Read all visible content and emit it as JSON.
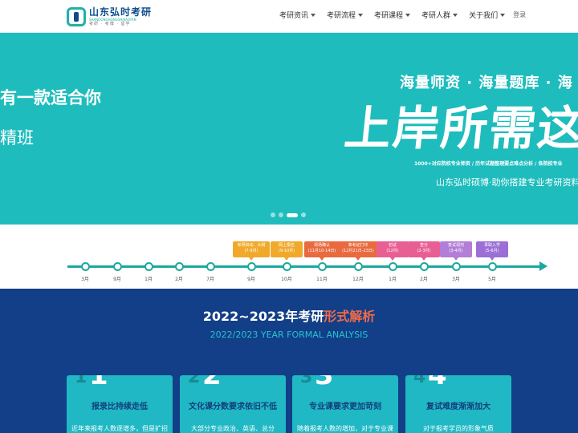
{
  "header": {
    "logo": {
      "name": "山东弘时考研",
      "pinyin": "SHANDONGHONGSHIKAOYAN",
      "sub": "考研 · 考博 · 留学"
    },
    "nav": [
      {
        "label": "考研资讯"
      },
      {
        "label": "考研流程"
      },
      {
        "label": "考研课程"
      },
      {
        "label": "考研人群"
      },
      {
        "label": "关于我们"
      }
    ],
    "login": "登录"
  },
  "banner": {
    "prev_slide_line1": "有一款适合你",
    "prev_slide_line2": "精班",
    "tagline": "海量师资 · 海量题库 · 海",
    "headline": "上岸所需这里",
    "fine_print": "1000+对应院校专业师资 / 历年试题整理要点难点分析 / 各院校专业",
    "subline": "山东弘时硕博·助你搭建专业考研资料",
    "active_dot": 2
  },
  "timeline": {
    "months": [
      "3月",
      "9月",
      "1月",
      "2月",
      "7月",
      "9月",
      "10月",
      "11月",
      "12月",
      "1月",
      "2月",
      "3月",
      "5月"
    ],
    "events": [
      {
        "line1": "考研启动、大纲",
        "line2": "(7-9月)",
        "color": "#f0a92b",
        "node": 5
      },
      {
        "line1": "网上报名",
        "line2": "(9-10月)",
        "color": "#f0a92b",
        "node": 6
      },
      {
        "line1": "现场确认",
        "line2": "(11月10-14日)",
        "color": "#e86a3e",
        "node": 7
      },
      {
        "line1": "准考证打印",
        "line2": "(12月21日-23日)",
        "color": "#e86a3e",
        "node": 8
      },
      {
        "line1": "初试",
        "line2": "(12月)",
        "color": "#e85f93",
        "node": 9
      },
      {
        "line1": "查分",
        "line2": "(2-3月)",
        "color": "#e85f93",
        "node": 10
      },
      {
        "line1": "复试调剂",
        "line2": "(3-4月)",
        "color": "#b27ed8",
        "node": 11
      },
      {
        "line1": "录取入学",
        "line2": "(5-6月)",
        "color": "#9b6fd6",
        "node": 12
      }
    ]
  },
  "analysis": {
    "title_main": "2022~2023年考研",
    "title_highlight": "形式解析",
    "subtitle": "2022/2023 YEAR FORMAL ANALYSIS",
    "cards": [
      {
        "num": "1",
        "title": "报录比持续走低",
        "text": "近年来报考人数逐增多，但是扩招"
      },
      {
        "num": "2",
        "title": "文化课分数要求依旧不低",
        "text": "大部分专业政治、英语、总分"
      },
      {
        "num": "3",
        "title": "专业课要求更加苛刻",
        "text": "随着报考人数的增加，对于专业课"
      },
      {
        "num": "4",
        "title": "复试难度渐渐加大",
        "text": "对于报考学员的形象气质"
      }
    ]
  }
}
